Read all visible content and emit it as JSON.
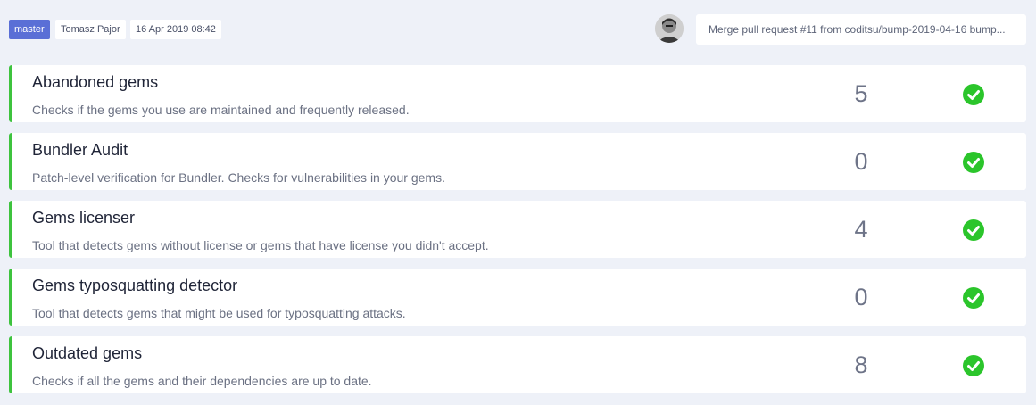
{
  "header": {
    "branch": "master",
    "author": "Tomasz Pajor",
    "date": "16 Apr 2019 08:42",
    "commit_message": "Merge pull request #11 from coditsu/bump-2019-04-16 bump..."
  },
  "colors": {
    "accent": "#5a6fd6",
    "success": "#3ec33e",
    "background": "#eef1f8"
  },
  "checks": [
    {
      "title": "Abandoned gems",
      "description": "Checks if the gems you use are maintained and frequently released.",
      "count": "5",
      "status": "check-circle-icon"
    },
    {
      "title": "Bundler Audit",
      "description": "Patch-level verification for Bundler. Checks for vulnerabilities in your gems.",
      "count": "0",
      "status": "check-circle-icon"
    },
    {
      "title": "Gems licenser",
      "description": "Tool that detects gems without license or gems that have license you didn't accept.",
      "count": "4",
      "status": "check-circle-icon"
    },
    {
      "title": "Gems typosquatting detector",
      "description": "Tool that detects gems that might be used for typosquatting attacks.",
      "count": "0",
      "status": "check-circle-icon"
    },
    {
      "title": "Outdated gems",
      "description": "Checks if all the gems and their dependencies are up to date.",
      "count": "8",
      "status": "check-circle-icon"
    }
  ]
}
